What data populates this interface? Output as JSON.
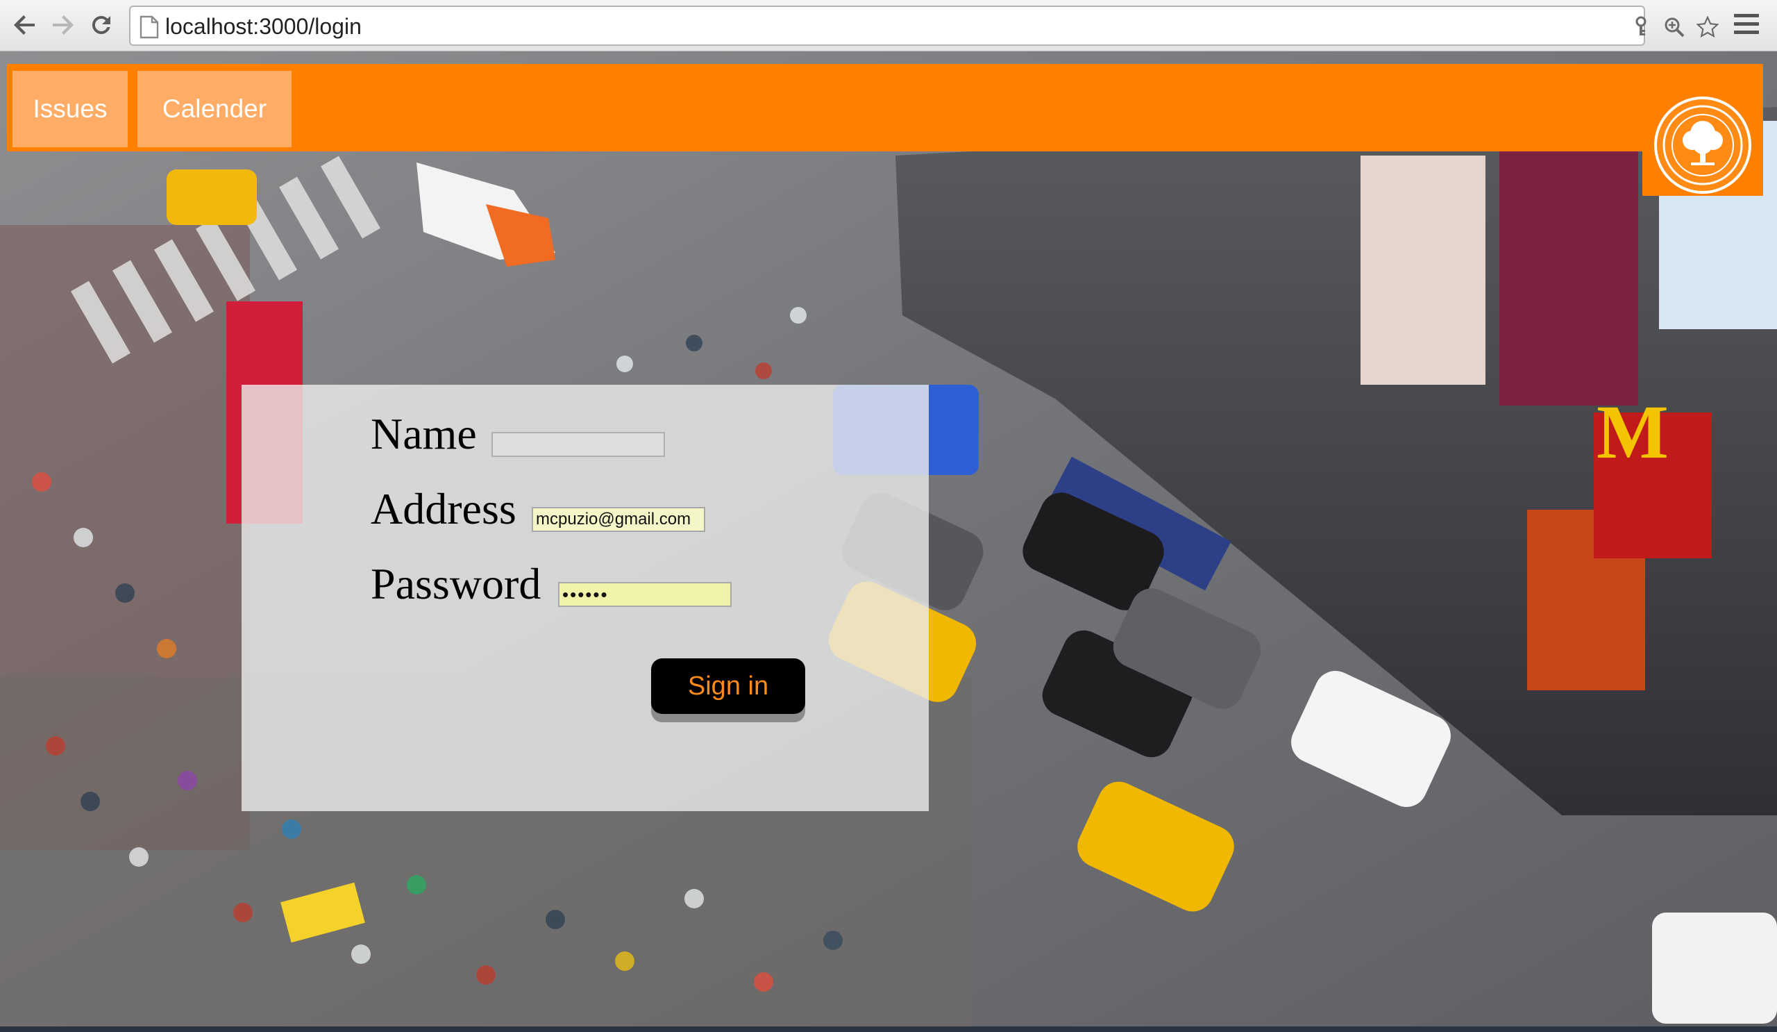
{
  "browser": {
    "url_host": "localhost",
    "url_rest": ":3000/login"
  },
  "nav": {
    "items": [
      {
        "label": "Issues"
      },
      {
        "label": "Calender"
      }
    ]
  },
  "login": {
    "name_label": "Name",
    "name_value": "",
    "address_label": "Address",
    "address_value": "mcpuzio@gmail.com",
    "password_label": "Password",
    "password_value": "123456",
    "submit_label": "Sign in"
  },
  "colors": {
    "accent": "#ff8000",
    "nav_link_bg": "#ffad66",
    "button_bg": "#000000",
    "button_text": "#ff8a1a"
  },
  "icons": {
    "back": "arrow-left-icon",
    "forward": "arrow-right-icon",
    "reload": "reload-icon",
    "page": "page-icon",
    "key": "key-icon",
    "zoom": "zoom-icon",
    "star": "star-icon",
    "menu": "hamburger-menu-icon",
    "logo": "city-seal-tree-logo"
  }
}
